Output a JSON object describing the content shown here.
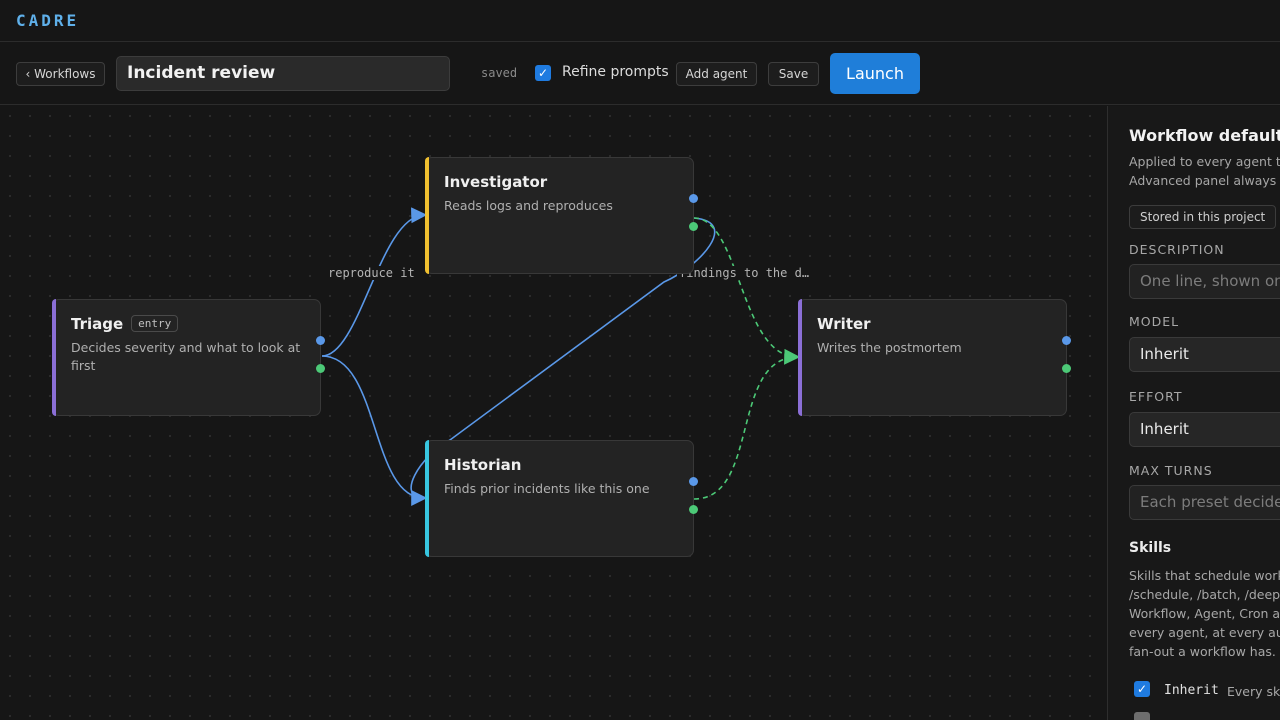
{
  "app": {
    "logo": "CADRE"
  },
  "toolbar": {
    "back_label": "‹ Workflows",
    "workflow_name": "Incident review",
    "save_status": "saved",
    "refine_label": "Refine prompts",
    "refine_checked": true,
    "add_agent_label": "Add agent",
    "save_label": "Save",
    "launch_label": "Launch"
  },
  "nodes": {
    "triage": {
      "name": "Triage",
      "badge": "entry",
      "desc": "Decides severity and what to look at first",
      "color": "#8b6fd6"
    },
    "investigator": {
      "name": "Investigator",
      "desc": "Reads logs and reproduces",
      "color": "#f0c030"
    },
    "historian": {
      "name": "Historian",
      "desc": "Finds prior incidents like this one",
      "color": "#38c6e0"
    },
    "writer": {
      "name": "Writer",
      "desc": "Writes the postmortem",
      "color": "#8b6fd6"
    }
  },
  "edges": {
    "reproduce_label": "reproduce it",
    "findings_label": "findings to the d…"
  },
  "panel": {
    "title": "Workflow defaults",
    "subtitle_1": "Applied to every agent th",
    "subtitle_2": "Advanced panel always w",
    "storage_pill": "Stored in this project",
    "description_label": "DESCRIPTION",
    "description_placeholder": "One line, shown on",
    "model_label": "MODEL",
    "model_value": "Inherit",
    "effort_label": "EFFORT",
    "effort_value": "Inherit",
    "max_turns_label": "MAX TURNS",
    "max_turns_placeholder": "Each preset decides",
    "skills_title": "Skills",
    "skills_desc": [
      "Skills that schedule work",
      "/schedule, /batch, /deep-",
      "Workflow, Agent, Cron an",
      "every agent, at every auto",
      "fan-out a workflow has."
    ],
    "inherit_code": "Inherit",
    "inherit_desc": "Every skil"
  },
  "colors": {
    "accent": "#1f7ed9",
    "edge_blue": "#5a98e8",
    "edge_green": "#4cc977"
  }
}
